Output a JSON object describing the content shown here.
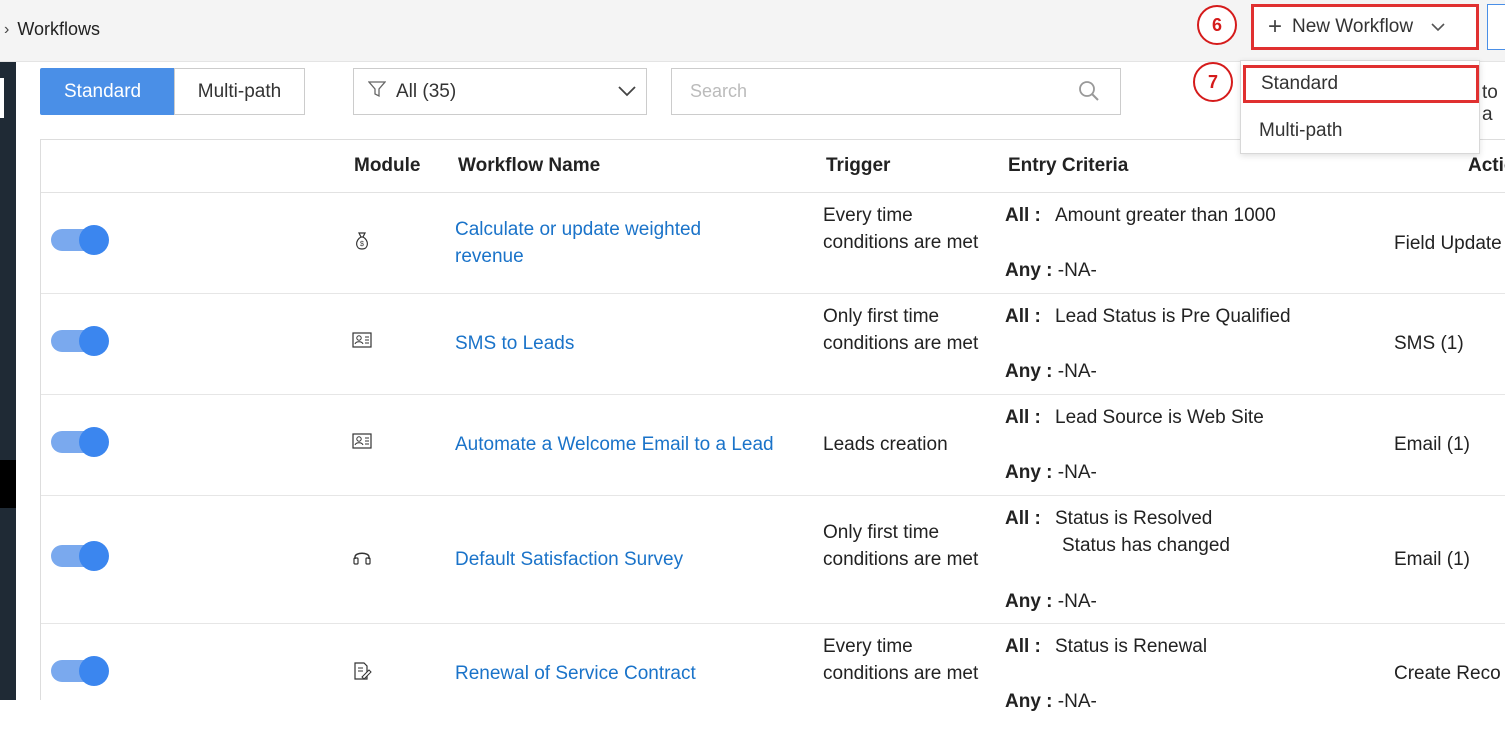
{
  "breadcrumb": {
    "label": "Workflows"
  },
  "header": {
    "new_workflow_label": "New Workflow",
    "step6": "6",
    "step7": "7",
    "dropdown": [
      "Standard",
      "Multi-path"
    ],
    "overflow_text": "to a"
  },
  "toolbar": {
    "tab_standard": "Standard",
    "tab_multipath": "Multi-path",
    "filter_label": "All (35)",
    "search_placeholder": "Search"
  },
  "table": {
    "headers": {
      "module": "Module",
      "name": "Workflow Name",
      "trigger": "Trigger",
      "criteria": "Entry Criteria",
      "action": "Actio"
    },
    "all_label": "All :",
    "any_label": "Any :",
    "rows": [
      {
        "module_icon": "money-bag-icon",
        "name": "Calculate or update weighted revenue",
        "trigger": "Every time conditions are met",
        "all": "Amount greater than 1000",
        "all2": "",
        "any": "-NA-",
        "action": "Field Update"
      },
      {
        "module_icon": "contact-card-icon",
        "name": "SMS to Leads",
        "trigger": "Only first time conditions are met",
        "all": "Lead Status is Pre Qualified",
        "all2": "",
        "any": "-NA-",
        "action": "SMS (1)"
      },
      {
        "module_icon": "contact-card-icon",
        "name": "Automate a Welcome Email to a Lead",
        "trigger": "Leads creation",
        "all": "Lead Source is Web Site",
        "all2": "",
        "any": "-NA-",
        "action": "Email (1)"
      },
      {
        "module_icon": "headset-icon",
        "name": "Default Satisfaction Survey",
        "trigger": "Only first time conditions are met",
        "all": "Status is Resolved",
        "all2": "Status has changed",
        "any": "-NA-",
        "action": "Email (1)"
      },
      {
        "module_icon": "edit-document-icon",
        "name": "Renewal of Service Contract",
        "trigger": "Every time conditions are met",
        "all": "Status is Renewal",
        "all2": "",
        "any": "-NA-",
        "action": "Create Reco"
      }
    ]
  },
  "colors": {
    "accent": "#4a8fe7",
    "link": "#1a73c9",
    "highlight": "#e03030"
  }
}
